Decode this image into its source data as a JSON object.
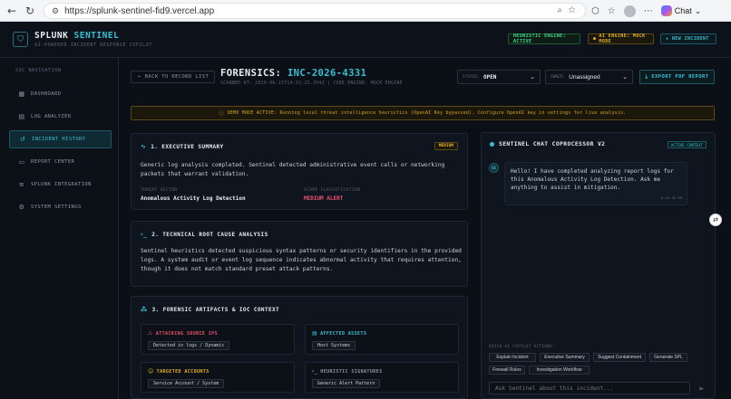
{
  "browser": {
    "url": "https://splunk-sentinel-fid9.vercel.app",
    "chat_label": "Chat"
  },
  "header": {
    "brand_main": "SPLUNK ",
    "brand_accent": "SENTINEL",
    "subtitle": "AI-POWERED INCIDENT RESPONSE COPILOT",
    "heuristic_pill": "HEURISTIC ENGINE: ACTIVE",
    "ai_pill": "AI ENGINE: MOCK MODE",
    "new_incident": "+ NEW INCIDENT",
    "colors": {
      "accent": "#36c0d4",
      "success": "#3ddc84",
      "warning": "#e6b422",
      "danger": "#f0506e"
    }
  },
  "sidebar": {
    "heading": "SOC NAVIGATION",
    "items": [
      {
        "label": "DASHBOARD",
        "icon": "grid-icon"
      },
      {
        "label": "LOG ANALYZER",
        "icon": "document-icon"
      },
      {
        "label": "INCIDENT HISTORY",
        "icon": "history-icon"
      },
      {
        "label": "REPORT CENTER",
        "icon": "book-icon"
      },
      {
        "label": "SPLUNK INTEGRATION",
        "icon": "database-icon"
      },
      {
        "label": "SYSTEM SETTINGS",
        "icon": "gear-icon"
      }
    ],
    "active_index": 2
  },
  "incident": {
    "back_label": "BACK TO RECORD LIST",
    "title_prefix": "FORENSICS: ",
    "incident_id": "INC-2026-4331",
    "scan_meta": "SCANNED AT: 2026-06-15T14:32:25.354Z | CORE ENGINE: MOCK ENGINE",
    "status_label": "STATUS:",
    "status_value": "OPEN",
    "owner_label": "OWNER:",
    "owner_value": "Unassigned",
    "export_label": "EXPORT PDF REPORT"
  },
  "banner": "DEMO MODE ACTIVE: Running local threat intelligence heuristics (OpenAI Key bypassed). Configure OpenAI key in settings for live analysis.",
  "summary": {
    "title": "1. EXECUTIVE SUMMARY",
    "badge": "MEDIUM",
    "text_line1": "Generic log analysis completed. Sentinel detected administrative event calls or networking",
    "text_line2": "packets that warrant validation.",
    "vector_label": "THREAT VECTOR",
    "vector_value": "Anomalous Activity Log Detection",
    "scope_label": "SCOPE CLASSIFICATION",
    "scope_value": "MEDIUM ALERT"
  },
  "root_cause": {
    "title": "2. TECHNICAL ROOT CAUSE ANALYSIS",
    "line1": "Sentinel heuristics detected suspicious syntax patterns or security identifiers in the provided",
    "line2": "logs. A system audit or event log sequence indicates abnormal activity that requires attention,",
    "line3": "though it does not match standard preset attack patterns."
  },
  "artifacts": {
    "title": "3. FORENSIC ARTIFACTS & IOC CONTEXT",
    "items": [
      {
        "title": "ATTACKING SOURCE IPS",
        "value": "Detected in logs / Dynamic",
        "color": "#f0506e",
        "icon": "warning-icon"
      },
      {
        "title": "AFFECTED ASSETS",
        "value": "Host Systems",
        "color": "#36c0d4",
        "icon": "server-icon"
      },
      {
        "title": "TARGETED ACCOUNTS",
        "value": "Service Account / System",
        "color": "#e6b422",
        "icon": "user-icon"
      },
      {
        "title": "HEURISTIC SIGNATURES",
        "value": "Generic Alert Pattern",
        "color": "#8b96a5",
        "icon": "terminal-icon"
      }
    ]
  },
  "chat": {
    "title": "SENTINEL CHAT COPROCESSOR V2",
    "badge": "ACTIVE CONTEXT",
    "avatar": "SS",
    "message": "Hello! I have completed analyzing report logs for this Anomalous Activity Log Detection. Ask me anything to assist in mitigation.",
    "time": "6:03:36 PM",
    "quick_label": "QUICK AI COPILOT ACTIONS:",
    "quick_actions": [
      "Explain Incident",
      "Executive Summary",
      "Suggest Containment",
      "Generate SPL",
      "Firewall Rules",
      "Investigation Workflow"
    ],
    "placeholder": "Ask Sentinel about this incident..."
  }
}
